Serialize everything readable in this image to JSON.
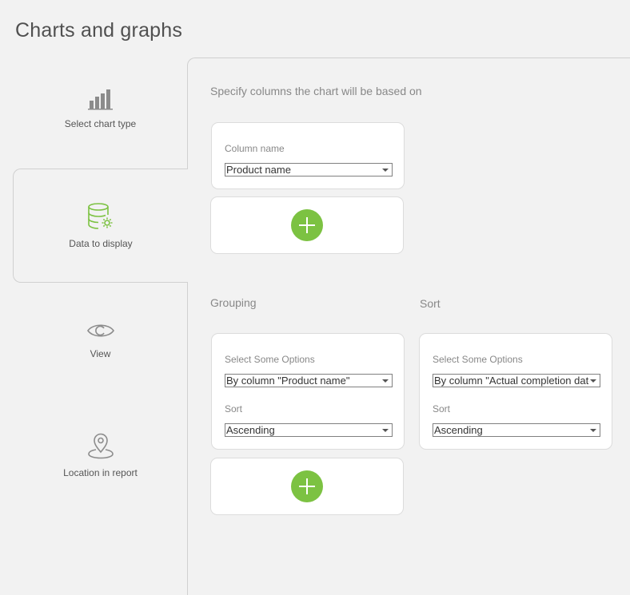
{
  "page": {
    "title": "Charts and graphs"
  },
  "sidebar": {
    "items": [
      {
        "label": "Select chart type",
        "icon": "bar-chart-icon",
        "active": false
      },
      {
        "label": "Data to display",
        "icon": "database-gear-icon",
        "active": true
      },
      {
        "label": "View",
        "icon": "eye-icon",
        "active": false
      },
      {
        "label": "Location in report",
        "icon": "location-pin-icon",
        "active": false
      }
    ]
  },
  "main": {
    "instructions": "Specify columns the chart will be based on",
    "columns_card": {
      "label": "Column name",
      "value": "Product name"
    },
    "grouping": {
      "heading": "Grouping",
      "options_label": "Select Some Options",
      "options_value": "By column \"Product name\"",
      "sort_label": "Sort",
      "sort_value": "Ascending"
    },
    "sort": {
      "heading": "Sort",
      "options_label": "Select Some Options",
      "options_value": "By column \"Actual completion date\"",
      "sort_label": "Sort",
      "sort_value": "Ascending"
    }
  },
  "colors": {
    "accent_green": "#7cc242",
    "background": "#f2f2f2",
    "card": "#ffffff",
    "icon_gray": "#8c8c8c"
  }
}
